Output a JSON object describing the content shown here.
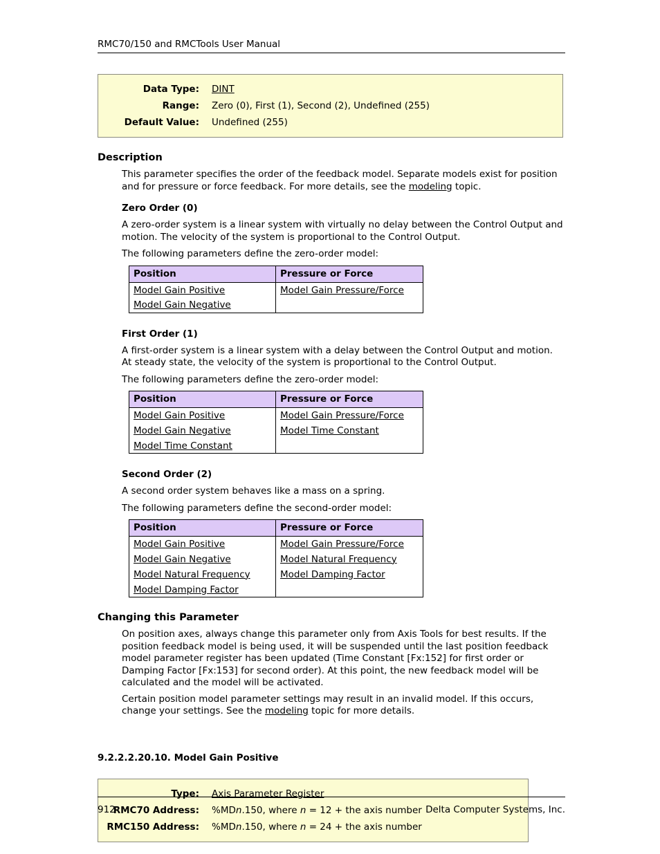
{
  "header": {
    "running_title": "RMC70/150 and RMCTools User Manual"
  },
  "param_box": {
    "rows": [
      {
        "label": "Data Type:",
        "value": "DINT",
        "link": true
      },
      {
        "label": "Range:",
        "value": "Zero (0), First (1), Second (2), Undefined (255)",
        "link": false
      },
      {
        "label": "Default Value:",
        "value": "Undefined (255)",
        "link": false
      }
    ]
  },
  "description": {
    "heading": "Description",
    "intro_part1": "This parameter specifies the order of the feedback model. Separate models exist for position and for pressure or force feedback. For more details, see the ",
    "intro_link": "modeling",
    "intro_part2": " topic."
  },
  "zero_order": {
    "heading": "Zero Order (0)",
    "paragraph": "A zero-order system is a linear system with virtually no delay between the Control Output and motion. The velocity of the system is proportional to the Control Output.",
    "table_intro": "The following parameters define the zero-order model:",
    "table": {
      "columns": [
        "Position",
        "Pressure or Force"
      ],
      "rows": [
        [
          "Model Gain Positive",
          "Model Gain Pressure/Force"
        ],
        [
          "Model Gain Negative",
          ""
        ]
      ]
    }
  },
  "first_order": {
    "heading": "First Order (1)",
    "paragraph": "A first-order system is a linear system with a delay between the Control Output and motion. At steady state, the velocity of the system is proportional to the Control Output.",
    "table_intro": "The following parameters define the zero-order model:",
    "table": {
      "columns": [
        "Position",
        "Pressure or Force"
      ],
      "rows": [
        [
          "Model Gain Positive",
          "Model Gain Pressure/Force"
        ],
        [
          "Model Gain Negative",
          "Model Time Constant"
        ],
        [
          "Model Time Constant",
          ""
        ]
      ]
    }
  },
  "second_order": {
    "heading": "Second Order (2)",
    "paragraph": "A second order system behaves like a mass on a spring.",
    "table_intro": "The following parameters define the second-order model:",
    "table": {
      "columns": [
        "Position",
        "Pressure or Force"
      ],
      "rows": [
        [
          "Model Gain Positive",
          "Model Gain Pressure/Force"
        ],
        [
          "Model Gain Negative",
          "Model Natural Frequency"
        ],
        [
          "Model Natural Frequency",
          "Model Damping Factor"
        ],
        [
          "Model Damping Factor",
          ""
        ]
      ]
    }
  },
  "changing": {
    "heading": "Changing this Parameter",
    "paragraph1": "On position axes, always change this parameter only from Axis Tools for best results. If the position feedback model is being used, it will be suspended until the last position feedback model parameter register has been updated (Time Constant [Fx:152] for first order or Damping Factor [Fx:153] for second order). At this point, the new feedback model will be calculated and the model will be activated.",
    "paragraph2_part1": "Certain position model parameter settings may result in an invalid model. If this occurs, change your settings. See the ",
    "paragraph2_link": "modeling",
    "paragraph2_part2": " topic for more details."
  },
  "next_section": {
    "heading": "9.2.2.2.20.10. Model Gain Positive",
    "box": {
      "rows": [
        {
          "label": "Type:",
          "value": "Axis Parameter Register",
          "link": true
        },
        {
          "label": "RMC70 Address:",
          "value_pre": "%MD",
          "value_ital": "n",
          "value_mid": ".150, where ",
          "value_ital2": "n",
          "value_post": " = 12 + the axis number",
          "link": false
        },
        {
          "label": "RMC150 Address:",
          "value_pre": "%MD",
          "value_ital": "n",
          "value_mid": ".150, where ",
          "value_ital2": "n",
          "value_post": " = 24 + the axis number",
          "link": false
        }
      ]
    }
  },
  "footer": {
    "page_number": "912",
    "company": "Delta Computer Systems, Inc."
  },
  "colors": {
    "infobox_bg": "#fcfcd2",
    "infobox_border": "#8a8a7e",
    "table_header_bg": "#ddc9f7",
    "rule": "#000000",
    "text": "#000000"
  }
}
